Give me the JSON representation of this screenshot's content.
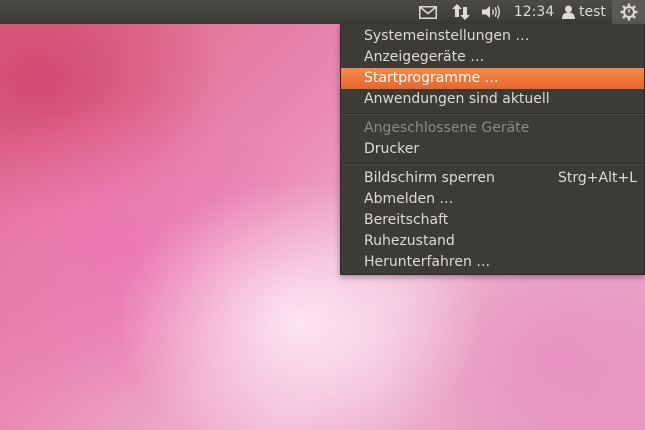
{
  "panel": {
    "clock": "12:34",
    "user": "test",
    "icons": {
      "mail": "envelope-icon",
      "network": "network-arrows-icon",
      "sound": "speaker-icon",
      "user": "person-icon",
      "session": "gear-power-icon"
    }
  },
  "menu": {
    "items": [
      {
        "label": "Systemeinstellungen …",
        "state": "normal"
      },
      {
        "label": "Anzeigegeräte …",
        "state": "normal"
      },
      {
        "label": "Startprogramme …",
        "state": "highlighted"
      },
      {
        "label": "Anwendungen sind aktuell",
        "state": "normal"
      },
      {
        "label": "Angeschlossene Geräte",
        "state": "disabled"
      },
      {
        "label": "Drucker",
        "state": "normal"
      },
      {
        "label": "Bildschirm sperren",
        "shortcut": "Strg+Alt+L",
        "state": "normal"
      },
      {
        "label": "Abmelden …",
        "state": "normal"
      },
      {
        "label": "Bereitschaft",
        "state": "normal"
      },
      {
        "label": "Ruhezustand",
        "state": "normal"
      },
      {
        "label": "Herunterfahren …",
        "state": "normal"
      }
    ]
  },
  "colors": {
    "panel": "#3c3b37",
    "highlight": "#f07746",
    "text": "#dfdbd2",
    "disabled_text": "#8b8a85"
  }
}
